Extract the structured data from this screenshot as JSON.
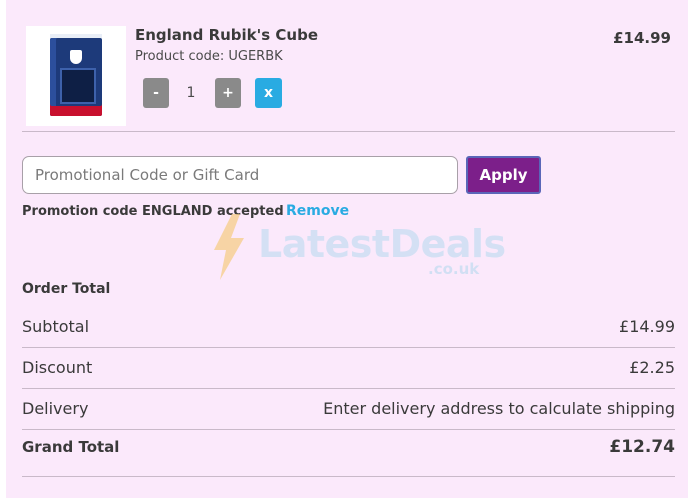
{
  "product": {
    "title": "England Rubik's Cube",
    "code": "Product code: UGERBK",
    "price": "£14.99",
    "quantity": "1",
    "minus_label": "-",
    "plus_label": "+",
    "remove_label": "x"
  },
  "promo": {
    "placeholder": "Promotional Code or Gift Card",
    "apply_label": "Apply",
    "accepted_text": "Promotion code ENGLAND accepted",
    "remove_label": "Remove"
  },
  "watermark": {
    "text": "LatestDeals",
    "subtext": ".co.uk"
  },
  "totals": {
    "heading": "Order Total",
    "subtotal_label": "Subtotal",
    "subtotal_value": "£14.99",
    "discount_label": "Discount",
    "discount_value": "£2.25",
    "delivery_label": "Delivery",
    "delivery_value": "Enter delivery address to calculate shipping",
    "grand_label": "Grand Total",
    "grand_value": "£12.74"
  },
  "colors": {
    "panel_bg": "#fbe9fb",
    "apply_bg": "#7c1f8a",
    "remove_accent": "#29abe2",
    "stepper_gray": "#8a8a8a"
  },
  "icons": {
    "product_image": "rubiks-cube-box-image",
    "watermark_logo": "lightning-bolt-icon"
  }
}
